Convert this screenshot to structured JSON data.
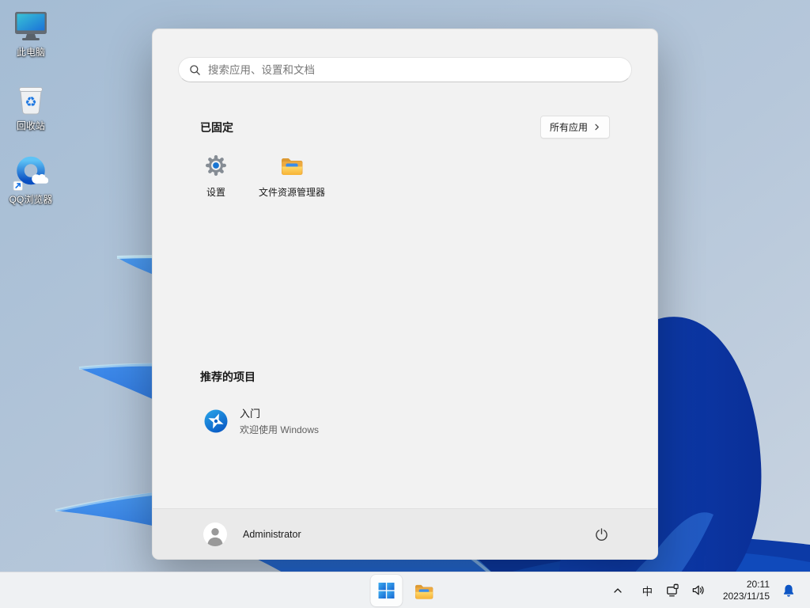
{
  "desktop": {
    "icons": [
      {
        "label": "此电脑",
        "icon": "this-pc-monitor"
      },
      {
        "label": "回收站",
        "icon": "recycle-bin"
      },
      {
        "label": "QQ浏览器",
        "icon": "qq-browser"
      }
    ]
  },
  "start_menu": {
    "search_placeholder": "搜索应用、设置和文档",
    "pinned_title": "已固定",
    "all_apps_label": "所有应用",
    "pinned_apps": [
      {
        "label": "设置",
        "icon": "settings-gear"
      },
      {
        "label": "文件资源管理器",
        "icon": "yellow-folder"
      }
    ],
    "recommended_title": "推荐的项目",
    "recommended_items": [
      {
        "title": "入门",
        "subtitle": "欢迎使用 Windows",
        "icon": "get-started-pinwheel"
      }
    ],
    "user_name": "Administrator"
  },
  "taskbar": {
    "ime_indicator": "中",
    "clock": {
      "time": "20:11",
      "date": "2023/11/15"
    }
  },
  "colors": {
    "accent_blue": "#1466cc",
    "bell_blue": "#0d55c4",
    "menu_bg": "#f2f2f2",
    "user_bar_bg": "#eaeaea",
    "taskbar_bg": "#eff1f3",
    "wallpaper_base": "#aec3d8"
  }
}
